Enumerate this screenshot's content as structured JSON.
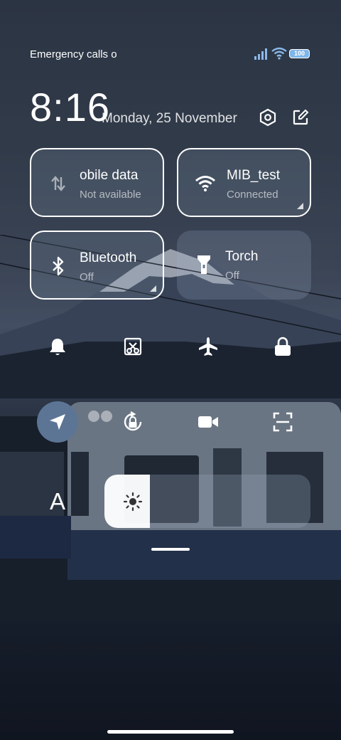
{
  "status_bar": {
    "carrier_text": "Emergency calls o",
    "battery_level": "100",
    "icons": [
      "signal-icon",
      "wifi-icon",
      "battery-icon"
    ]
  },
  "header": {
    "time": "8:16",
    "date": "Monday, 25 November",
    "settings_icon": "gear-icon",
    "edit_icon": "edit-icon"
  },
  "tiles": [
    {
      "id": "mobile-data",
      "title": "obile data",
      "subtitle": "Not available",
      "icon": "mobile-data-icon",
      "active": false
    },
    {
      "id": "wifi",
      "title": "MIB_test",
      "subtitle": "Connected",
      "icon": "wifi-icon",
      "active": true
    },
    {
      "id": "bluetooth",
      "title": "Bluetooth",
      "subtitle": "Off",
      "icon": "bluetooth-icon",
      "active": false
    },
    {
      "id": "torch",
      "title": "Torch",
      "subtitle": "Off",
      "icon": "torch-icon",
      "active": false
    }
  ],
  "toggles_row1": [
    "bell-icon",
    "screenshot-icon",
    "airplane-icon",
    "lock-icon"
  ],
  "toggles_row2": [
    "location-icon",
    "rotation-lock-icon",
    "video-icon",
    "scan-icon"
  ],
  "active_toggle": "location-icon",
  "brightness": {
    "auto_label": "A",
    "level": 0.22,
    "icon": "sun-icon"
  },
  "colors": {
    "active": "#5d7595",
    "battery_fill": "#7fb6e9"
  }
}
